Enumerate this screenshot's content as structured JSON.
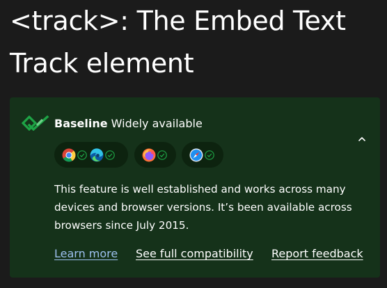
{
  "page": {
    "title_line1": "<track>: The Embed Text",
    "title_line2": "Track element"
  },
  "baseline": {
    "label_strong": "Baseline",
    "label_rest": " Widely available",
    "description": "This feature is well established and works across many devices and browser versions. It’s been available across browsers since July 2015.",
    "browsers": [
      "chrome",
      "edge",
      "firefox",
      "safari"
    ],
    "links": {
      "learn_more": "Learn more",
      "see_full_compat": "See full compatibility",
      "report_feedback": "Report feedback"
    },
    "colors": {
      "card_bg": "#15321a",
      "check_green": "#1ea446",
      "link_blue": "#9ec1f0"
    }
  }
}
